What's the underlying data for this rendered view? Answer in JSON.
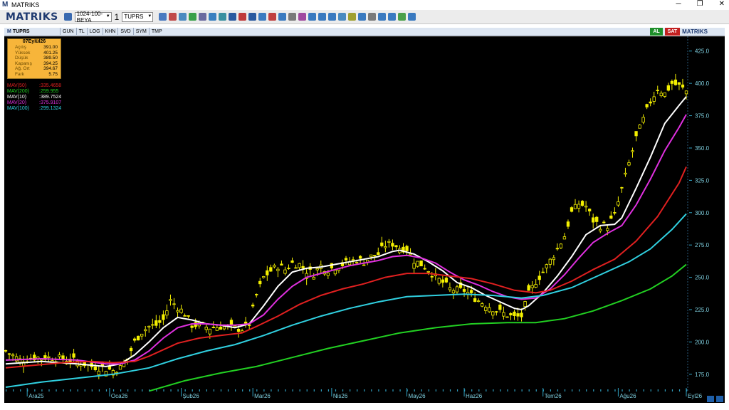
{
  "window": {
    "title": "MATRIKS",
    "minimize": "─",
    "restore": "❐",
    "close": "✕"
  },
  "toolbar": {
    "brand": "MATRIKS",
    "template_combo": "1024-100-BEYA",
    "count": "1",
    "symbol_combo": "TUPRS"
  },
  "tabbar": {
    "symbol": "TUPRS",
    "tabs": [
      "GUN",
      "TL",
      "LOG",
      "KHN",
      "SVD",
      "SYM",
      "TMP"
    ],
    "buy": "AL",
    "sell": "SAT",
    "brand": "MATRIKS"
  },
  "infobox": {
    "date": "07Eylül26",
    "rows": [
      {
        "key": "Açılış",
        "value": "391.00"
      },
      {
        "key": "Yüksek",
        "value": "401.25"
      },
      {
        "key": "Düşük",
        "value": "389.50"
      },
      {
        "key": "Kapanış",
        "value": "394.25"
      },
      {
        "key": "Ağ. Ort",
        "value": "394.67"
      },
      {
        "key": "Fark",
        "value": "5.75"
      }
    ]
  },
  "mav_labels": [
    {
      "name": "MAV(50)",
      "value": ":335.4658",
      "color": "#e02020"
    },
    {
      "name": "MAV(200)",
      "value": ":259.955",
      "color": "#22d022"
    },
    {
      "name": "MAV(10)",
      "value": ":389.7524",
      "color": "#ffffff"
    },
    {
      "name": "MAV(20)",
      "value": ":375.9107",
      "color": "#e030e0"
    },
    {
      "name": "MAV(100)",
      "value": ":299.1324",
      "color": "#30d0e0"
    }
  ],
  "chart_data": {
    "type": "line",
    "symbol": "TUPRS",
    "ylim": [
      165,
      432
    ],
    "y_ticks": [
      425,
      400,
      375,
      350,
      325,
      300,
      275,
      250,
      225,
      200,
      175
    ],
    "x_labels": [
      "Ara25",
      "Oca26",
      "Şub26",
      "Mar26",
      "Nis26",
      "May26",
      "Haz26",
      "Tem26",
      "Ağu26",
      "Eyl26"
    ],
    "n_bars": 190,
    "label_index": [
      6,
      29,
      49,
      69,
      91,
      112,
      128,
      150,
      171,
      190
    ],
    "candle_color": "#f4f000",
    "close": [
      [
        0,
        193
      ],
      [
        4,
        186
      ],
      [
        8,
        188
      ],
      [
        12,
        188
      ],
      [
        16,
        187
      ],
      [
        20,
        185
      ],
      [
        24,
        181
      ],
      [
        27,
        180
      ],
      [
        30,
        178
      ],
      [
        32,
        180
      ],
      [
        34,
        187
      ],
      [
        36,
        200
      ],
      [
        38,
        208
      ],
      [
        40,
        212
      ],
      [
        42,
        213
      ],
      [
        44,
        217
      ],
      [
        46,
        232
      ],
      [
        48,
        227
      ],
      [
        50,
        222
      ],
      [
        52,
        213
      ],
      [
        54,
        213
      ],
      [
        57,
        211
      ],
      [
        60,
        212
      ],
      [
        63,
        211
      ],
      [
        66,
        210
      ],
      [
        68,
        214
      ],
      [
        70,
        236
      ],
      [
        72,
        250
      ],
      [
        74,
        255
      ],
      [
        76,
        259
      ],
      [
        78,
        256
      ],
      [
        80,
        261
      ],
      [
        82,
        260
      ],
      [
        84,
        255
      ],
      [
        86,
        253
      ],
      [
        88,
        259
      ],
      [
        90,
        256
      ],
      [
        92,
        258
      ],
      [
        94,
        260
      ],
      [
        96,
        262
      ],
      [
        98,
        264
      ],
      [
        100,
        262
      ],
      [
        102,
        266
      ],
      [
        104,
        268
      ],
      [
        106,
        275
      ],
      [
        108,
        276
      ],
      [
        110,
        273
      ],
      [
        112,
        272
      ],
      [
        114,
        263
      ],
      [
        116,
        260
      ],
      [
        118,
        256
      ],
      [
        120,
        250
      ],
      [
        122,
        246
      ],
      [
        124,
        241
      ],
      [
        126,
        240
      ],
      [
        128,
        240
      ],
      [
        130,
        236
      ],
      [
        132,
        232
      ],
      [
        134,
        229
      ],
      [
        136,
        226
      ],
      [
        138,
        223
      ],
      [
        140,
        221
      ],
      [
        142,
        219
      ],
      [
        144,
        220
      ],
      [
        146,
        237
      ],
      [
        148,
        247
      ],
      [
        150,
        254
      ],
      [
        152,
        263
      ],
      [
        154,
        272
      ],
      [
        156,
        282
      ],
      [
        158,
        300
      ],
      [
        160,
        307
      ],
      [
        162,
        305
      ],
      [
        164,
        294
      ],
      [
        166,
        290
      ],
      [
        168,
        290
      ],
      [
        170,
        298
      ],
      [
        172,
        318
      ],
      [
        174,
        338
      ],
      [
        176,
        358
      ],
      [
        178,
        372
      ],
      [
        180,
        386
      ],
      [
        182,
        396
      ],
      [
        184,
        392
      ],
      [
        186,
        400
      ],
      [
        188,
        398
      ],
      [
        190,
        394
      ]
    ],
    "series": [
      {
        "name": "MAV(10)",
        "color": "#ffffff",
        "last": 389.7524,
        "points": [
          [
            0,
            183
          ],
          [
            10,
            185
          ],
          [
            20,
            183
          ],
          [
            28,
            181
          ],
          [
            32,
            183
          ],
          [
            36,
            190
          ],
          [
            40,
            200
          ],
          [
            44,
            211
          ],
          [
            48,
            219
          ],
          [
            52,
            217
          ],
          [
            56,
            214
          ],
          [
            60,
            213
          ],
          [
            64,
            211
          ],
          [
            68,
            214
          ],
          [
            72,
            228
          ],
          [
            76,
            243
          ],
          [
            80,
            254
          ],
          [
            84,
            257
          ],
          [
            88,
            258
          ],
          [
            92,
            260
          ],
          [
            96,
            262
          ],
          [
            100,
            264
          ],
          [
            104,
            266
          ],
          [
            108,
            270
          ],
          [
            110,
            271
          ],
          [
            114,
            268
          ],
          [
            118,
            262
          ],
          [
            122,
            255
          ],
          [
            126,
            246
          ],
          [
            130,
            242
          ],
          [
            134,
            236
          ],
          [
            138,
            231
          ],
          [
            142,
            226
          ],
          [
            144,
            225
          ],
          [
            146,
            228
          ],
          [
            150,
            238
          ],
          [
            154,
            251
          ],
          [
            158,
            266
          ],
          [
            162,
            283
          ],
          [
            166,
            290
          ],
          [
            170,
            291
          ],
          [
            172,
            296
          ],
          [
            176,
            319
          ],
          [
            180,
            343
          ],
          [
            184,
            369
          ],
          [
            188,
            383
          ],
          [
            190,
            389.75
          ]
        ]
      },
      {
        "name": "MAV(20)",
        "color": "#e030e0",
        "last": 375.9107,
        "points": [
          [
            0,
            186
          ],
          [
            10,
            187
          ],
          [
            20,
            186
          ],
          [
            28,
            183
          ],
          [
            32,
            183
          ],
          [
            36,
            186
          ],
          [
            40,
            193
          ],
          [
            44,
            203
          ],
          [
            48,
            211
          ],
          [
            52,
            214
          ],
          [
            56,
            214
          ],
          [
            60,
            213
          ],
          [
            64,
            213
          ],
          [
            68,
            214
          ],
          [
            72,
            221
          ],
          [
            76,
            233
          ],
          [
            80,
            243
          ],
          [
            84,
            250
          ],
          [
            88,
            253
          ],
          [
            92,
            256
          ],
          [
            96,
            259
          ],
          [
            100,
            261
          ],
          [
            104,
            263
          ],
          [
            108,
            266
          ],
          [
            112,
            267
          ],
          [
            116,
            265
          ],
          [
            120,
            261
          ],
          [
            124,
            254
          ],
          [
            128,
            248
          ],
          [
            132,
            244
          ],
          [
            136,
            239
          ],
          [
            140,
            235
          ],
          [
            144,
            233
          ],
          [
            148,
            234
          ],
          [
            152,
            241
          ],
          [
            156,
            252
          ],
          [
            160,
            265
          ],
          [
            164,
            277
          ],
          [
            168,
            284
          ],
          [
            172,
            290
          ],
          [
            176,
            306
          ],
          [
            180,
            326
          ],
          [
            184,
            348
          ],
          [
            188,
            366
          ],
          [
            190,
            375.91
          ]
        ]
      },
      {
        "name": "MAV(50)",
        "color": "#e02020",
        "last": 335.4658,
        "points": [
          [
            0,
            180
          ],
          [
            8,
            182
          ],
          [
            16,
            184
          ],
          [
            24,
            185
          ],
          [
            30,
            184
          ],
          [
            36,
            185
          ],
          [
            40,
            189
          ],
          [
            44,
            194
          ],
          [
            48,
            199
          ],
          [
            54,
            203
          ],
          [
            60,
            205
          ],
          [
            66,
            207
          ],
          [
            70,
            212
          ],
          [
            76,
            220
          ],
          [
            82,
            229
          ],
          [
            88,
            236
          ],
          [
            94,
            241
          ],
          [
            100,
            245
          ],
          [
            106,
            250
          ],
          [
            112,
            253
          ],
          [
            118,
            253
          ],
          [
            124,
            251
          ],
          [
            130,
            249
          ],
          [
            136,
            245
          ],
          [
            142,
            240
          ],
          [
            148,
            238
          ],
          [
            152,
            240
          ],
          [
            158,
            247
          ],
          [
            164,
            256
          ],
          [
            170,
            264
          ],
          [
            176,
            278
          ],
          [
            182,
            297
          ],
          [
            188,
            323
          ],
          [
            190,
            335.47
          ]
        ]
      },
      {
        "name": "MAV(100)",
        "color": "#30d0e0",
        "last": 299.1324,
        "points": [
          [
            0,
            165
          ],
          [
            10,
            169
          ],
          [
            20,
            172
          ],
          [
            30,
            175
          ],
          [
            40,
            180
          ],
          [
            48,
            187
          ],
          [
            56,
            193
          ],
          [
            64,
            198
          ],
          [
            72,
            205
          ],
          [
            80,
            213
          ],
          [
            88,
            220
          ],
          [
            96,
            226
          ],
          [
            104,
            231
          ],
          [
            112,
            235
          ],
          [
            120,
            236
          ],
          [
            128,
            237
          ],
          [
            136,
            236
          ],
          [
            144,
            234
          ],
          [
            150,
            236
          ],
          [
            158,
            242
          ],
          [
            166,
            252
          ],
          [
            174,
            262
          ],
          [
            180,
            272
          ],
          [
            186,
            287
          ],
          [
            190,
            299.13
          ]
        ]
      },
      {
        "name": "MAV(200)",
        "color": "#22d022",
        "last": 259.955,
        "points": [
          [
            40,
            162
          ],
          [
            50,
            170
          ],
          [
            60,
            176
          ],
          [
            70,
            181
          ],
          [
            80,
            188
          ],
          [
            90,
            195
          ],
          [
            100,
            201
          ],
          [
            110,
            207
          ],
          [
            120,
            211
          ],
          [
            130,
            214
          ],
          [
            140,
            215
          ],
          [
            148,
            215
          ],
          [
            156,
            218
          ],
          [
            164,
            224
          ],
          [
            172,
            232
          ],
          [
            180,
            241
          ],
          [
            186,
            251
          ],
          [
            190,
            259.96
          ]
        ]
      }
    ]
  }
}
